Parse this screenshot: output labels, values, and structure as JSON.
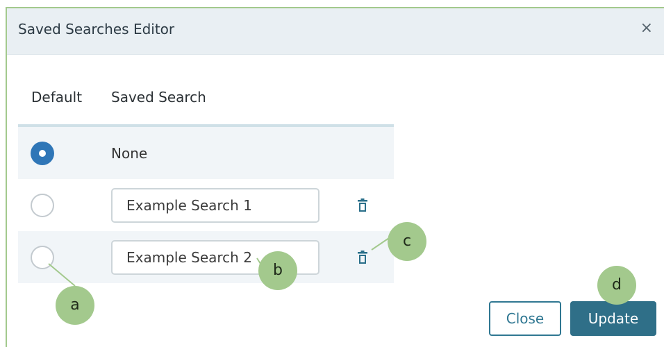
{
  "dialog": {
    "title": "Saved Searches Editor",
    "close_icon": "×"
  },
  "table": {
    "headers": {
      "default": "Default",
      "saved_search": "Saved Search"
    },
    "rows": [
      {
        "default": true,
        "name": "None",
        "editable": false
      },
      {
        "default": false,
        "name": "Example Search 1",
        "editable": true
      },
      {
        "default": false,
        "name": "Example Search 2",
        "editable": true
      }
    ]
  },
  "buttons": {
    "close": "Close",
    "update": "Update"
  },
  "callouts": {
    "a": "a",
    "b": "b",
    "c": "c",
    "d": "d"
  },
  "colors": {
    "accent": "#2f76b7",
    "primary_button": "#2f6f88",
    "callout": "#a3c98d"
  }
}
